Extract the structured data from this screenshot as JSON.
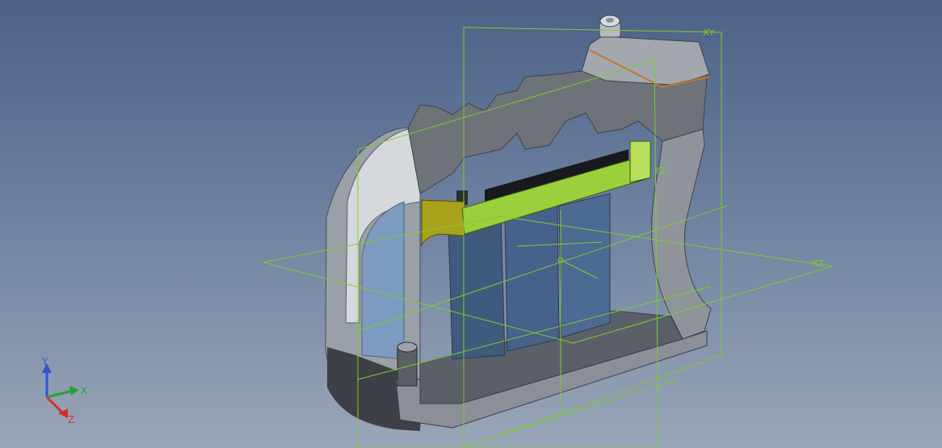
{
  "viewport": {
    "background_top": "#4d6187",
    "background_bottom": "#9aa6b8",
    "plane_color": "#7ccd2e"
  },
  "triad": {
    "x_label": "X",
    "y_label": "Y",
    "z_label": "Z",
    "x_color": "#1fa33a",
    "y_color": "#2f55d6",
    "z_color": "#d2302c"
  },
  "planes": {
    "xy_label": "XY",
    "yz_label": "YZ",
    "xz_label": "XZ"
  },
  "model": {
    "body_color": "#c7ccd3",
    "cut_face_color": "#8d939b",
    "highlight_color": "#9ccf3c",
    "accent_yellow": "#a8a21a",
    "glass_color": "#3f5a7d"
  }
}
